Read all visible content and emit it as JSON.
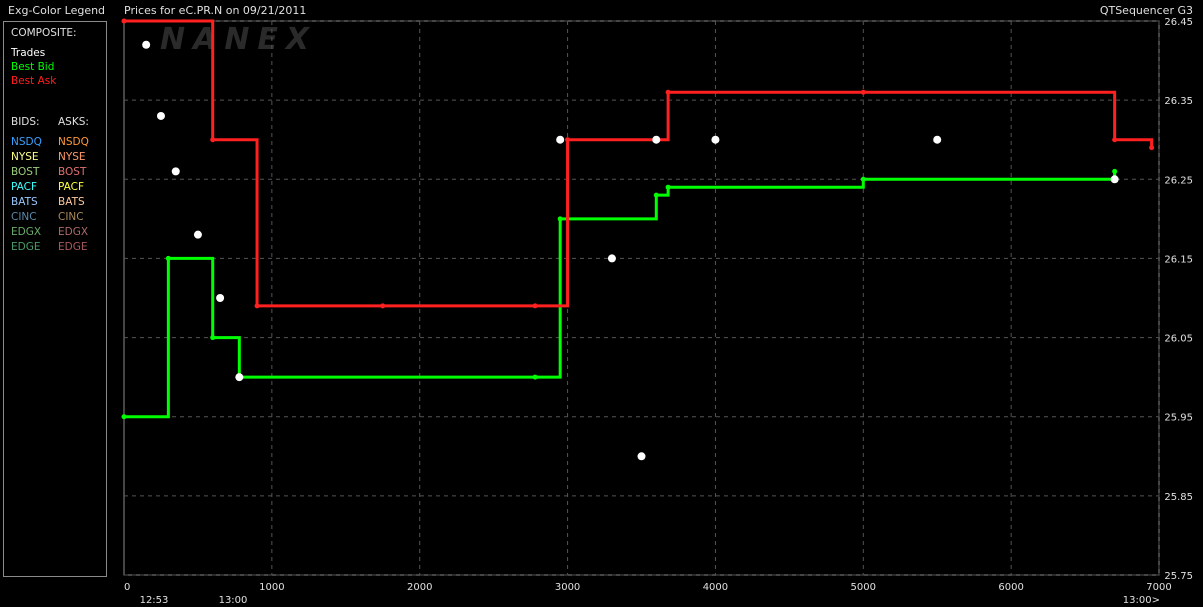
{
  "header": {
    "legend_title": "Exg-Color Legend",
    "chart_title": "Prices for  eC.PR.N  on  09/21/2011",
    "app_name": "QTSequencer G3",
    "watermark": "NANEX"
  },
  "legend": {
    "composite_label": "COMPOSITE:",
    "composite": [
      {
        "label": "Trades",
        "color": "#ffffff"
      },
      {
        "label": "Best Bid",
        "color": "#00ff00"
      },
      {
        "label": "Best Ask",
        "color": "#ff2020"
      }
    ],
    "bids_label": "BIDS:",
    "asks_label": "ASKS:",
    "exchanges": [
      {
        "bid": "NSDQ",
        "ask": "NSDQ",
        "bid_color": "#3aa0ff",
        "ask_color": "#ff9a3a"
      },
      {
        "bid": "NYSE",
        "ask": "NYSE",
        "bid_color": "#ffff88",
        "ask_color": "#ff9a6a"
      },
      {
        "bid": "BOST",
        "ask": "BOST",
        "bid_color": "#9acd7a",
        "ask_color": "#e07070"
      },
      {
        "bid": "PACF",
        "ask": "PACF",
        "bid_color": "#40ffff",
        "ask_color": "#ffff40"
      },
      {
        "bid": "BATS",
        "ask": "BATS",
        "bid_color": "#9ac8ff",
        "ask_color": "#ffc89a"
      },
      {
        "bid": "CINC",
        "ask": "CINC",
        "bid_color": "#5a8aaa",
        "ask_color": "#aa8a5a"
      },
      {
        "bid": "EDGX",
        "ask": "EDGX",
        "bid_color": "#6aaa6a",
        "ask_color": "#aa6a6a"
      },
      {
        "bid": "EDGE",
        "ask": "EDGE",
        "bid_color": "#4a9a6a",
        "ask_color": "#aa5a5a"
      }
    ]
  },
  "chart_data": {
    "type": "line",
    "x_ticks": [
      0,
      1000,
      2000,
      3000,
      4000,
      5000,
      6000,
      7000
    ],
    "x_tick_labels": [
      "0",
      "1000",
      "2000",
      "3000",
      "4000",
      "5000",
      "6000",
      "7000"
    ],
    "time_labels": [
      "12:53",
      "13:00",
      "13:00>"
    ],
    "xlim": [
      0,
      7000
    ],
    "y_ticks": [
      25.75,
      25.85,
      25.95,
      26.05,
      26.15,
      26.25,
      26.35,
      26.45
    ],
    "y_tick_labels": [
      "25.75",
      "25.85",
      "25.95",
      "26.05",
      "26.15",
      "26.25",
      "26.35",
      "26.45"
    ],
    "ylim": [
      25.75,
      26.45
    ],
    "grid": true,
    "series": [
      {
        "name": "Best Bid",
        "points": [
          [
            0,
            25.95
          ],
          [
            300,
            26.15
          ],
          [
            600,
            26.05
          ],
          [
            780,
            26.0
          ],
          [
            2780,
            26.0
          ],
          [
            2950,
            26.2
          ],
          [
            3600,
            26.23
          ],
          [
            3680,
            26.24
          ],
          [
            5000,
            26.25
          ],
          [
            6700,
            26.26
          ]
        ]
      },
      {
        "name": "Best Ask",
        "points": [
          [
            0,
            26.45
          ],
          [
            600,
            26.3
          ],
          [
            900,
            26.09
          ],
          [
            1750,
            26.09
          ],
          [
            2780,
            26.09
          ],
          [
            3000,
            26.3
          ],
          [
            3680,
            26.36
          ],
          [
            5000,
            26.36
          ],
          [
            6700,
            26.3
          ],
          [
            6950,
            26.29
          ]
        ]
      },
      {
        "name": "Trades",
        "points": [
          [
            150,
            26.42
          ],
          [
            250,
            26.33
          ],
          [
            350,
            26.26
          ],
          [
            500,
            26.18
          ],
          [
            650,
            26.1
          ],
          [
            780,
            26.0
          ],
          [
            2950,
            26.3
          ],
          [
            3300,
            26.15
          ],
          [
            3500,
            25.9
          ],
          [
            3600,
            26.3
          ],
          [
            4000,
            26.3
          ],
          [
            5500,
            26.3
          ],
          [
            6700,
            26.25
          ]
        ]
      }
    ]
  }
}
